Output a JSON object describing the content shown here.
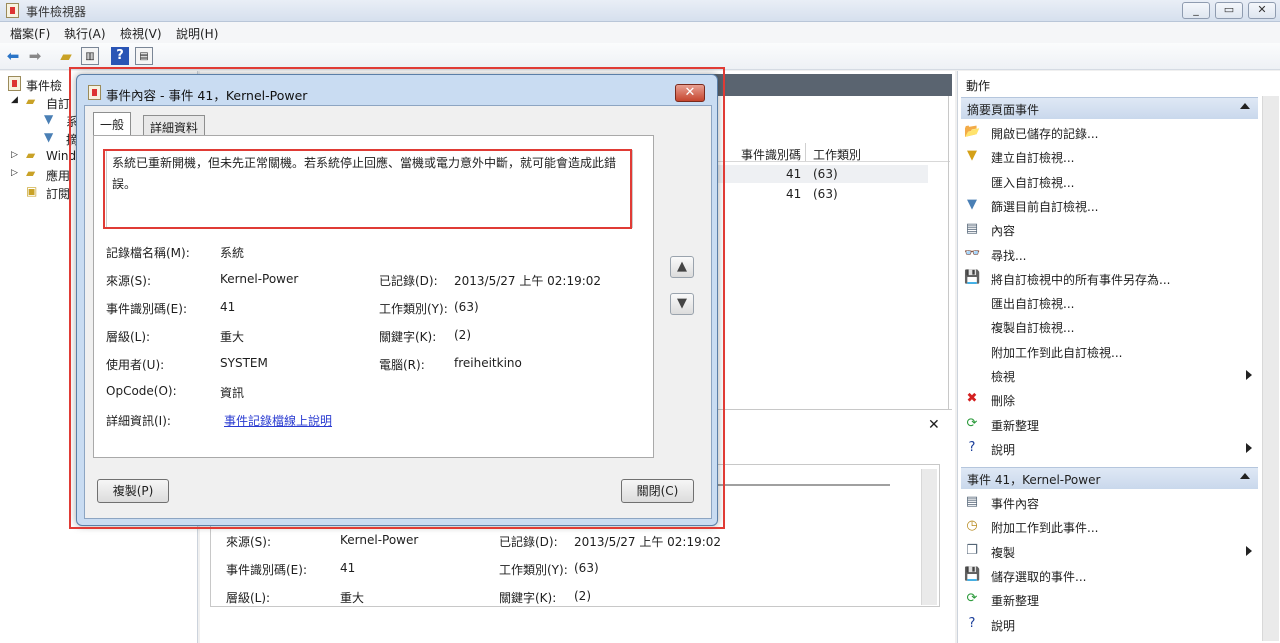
{
  "window": {
    "title": "事件檢視器",
    "controls": [
      "_",
      "▭",
      "✕"
    ]
  },
  "menu": [
    "檔案(F)",
    "執行(A)",
    "檢視(V)",
    "說明(H)"
  ],
  "tree": {
    "items": [
      "事件檢",
      "自訂",
      "系",
      "摘",
      "Wind",
      "應用",
      "訂閱"
    ]
  },
  "center": {
    "columns": [
      "事件識別碼",
      "工作類別"
    ],
    "rows": [
      {
        "id": "41",
        "category": "(63)"
      },
      {
        "id": "41",
        "category": "(63)"
      }
    ],
    "preview_close": "✕",
    "preview": {
      "source_label": "來源(S):",
      "source_value": "Kernel-Power",
      "logged_label": "已記錄(D):",
      "logged_value": "2013/5/27 上午 02:19:02",
      "eventid_label": "事件識別碼(E):",
      "eventid_value": "41",
      "task_label": "工作類別(Y):",
      "task_value": "(63)",
      "level_label": "層級(L):",
      "level_value": "重大",
      "keywords_label": "關鍵字(K):",
      "keywords_value": "(2)"
    }
  },
  "actions": {
    "header": "動作",
    "section1": "摘要頁面事件",
    "items1": [
      {
        "label": "開啟已儲存的記錄...",
        "icon": "open-folder-icon",
        "glyph": "📂",
        "color": "#c9a227"
      },
      {
        "label": "建立自訂檢視...",
        "icon": "filter-icon",
        "glyph": "▼",
        "color": "#d4a017"
      },
      {
        "label": "匯入自訂檢視...",
        "icon": "",
        "glyph": "",
        "color": "#000"
      },
      {
        "label": "篩選目前自訂檢視...",
        "icon": "filter-icon",
        "glyph": "▼",
        "color": "#4a7fb5"
      },
      {
        "label": "內容",
        "icon": "properties-icon",
        "glyph": "▤",
        "color": "#567"
      },
      {
        "label": "尋找...",
        "icon": "binoculars-icon",
        "glyph": "👓",
        "color": "#335"
      },
      {
        "label": "將自訂檢視中的所有事件另存為...",
        "icon": "save-icon",
        "glyph": "💾",
        "color": "#335"
      },
      {
        "label": "匯出自訂檢視...",
        "icon": "",
        "glyph": "",
        "color": "#000"
      },
      {
        "label": "複製自訂檢視...",
        "icon": "",
        "glyph": "",
        "color": "#000"
      },
      {
        "label": "附加工作到此自訂檢視...",
        "icon": "",
        "glyph": "",
        "color": "#000"
      },
      {
        "label": "檢視",
        "icon": "",
        "glyph": "",
        "color": "#000",
        "submenu": true
      },
      {
        "label": "刪除",
        "icon": "delete-icon",
        "glyph": "✖",
        "color": "#d42020"
      },
      {
        "label": "重新整理",
        "icon": "refresh-icon",
        "glyph": "⟳",
        "color": "#2a9a3a"
      },
      {
        "label": "說明",
        "icon": "help-icon",
        "glyph": "?",
        "color": "#1c3f9a",
        "submenu": true
      }
    ],
    "section2": "事件 41，Kernel-Power",
    "items2": [
      {
        "label": "事件內容",
        "icon": "event-properties-icon",
        "glyph": "▤",
        "color": "#567"
      },
      {
        "label": "附加工作到此事件...",
        "icon": "task-icon",
        "glyph": "◷",
        "color": "#b78a1f"
      },
      {
        "label": "複製",
        "icon": "copy-icon",
        "glyph": "❐",
        "color": "#567",
        "submenu": true
      },
      {
        "label": "儲存選取的事件...",
        "icon": "save-icon",
        "glyph": "💾",
        "color": "#335"
      },
      {
        "label": "重新整理",
        "icon": "refresh-icon",
        "glyph": "⟳",
        "color": "#2a9a3a"
      },
      {
        "label": "說明",
        "icon": "help-icon",
        "glyph": "?",
        "color": "#1c3f9a"
      }
    ]
  },
  "dialog": {
    "title": "事件內容 - 事件 41，Kernel-Power",
    "tabs": [
      "一般",
      "詳細資料"
    ],
    "description": "系統已重新開機，但未先正常關機。若系統停止回應、當機或電力意外中斷，就可能會造成此錯誤。",
    "log_name_label": "記錄檔名稱(M):",
    "log_name_value": "系統",
    "source_label": "來源(S):",
    "source_value": "Kernel-Power",
    "logged_label": "已記錄(D):",
    "logged_value": "2013/5/27 上午 02:19:02",
    "eventid_label": "事件識別碼(E):",
    "eventid_value": "41",
    "task_label": "工作類別(Y):",
    "task_value": "(63)",
    "level_label": "層級(L):",
    "level_value": "重大",
    "keywords_label": "關鍵字(K):",
    "keywords_value": "(2)",
    "user_label": "使用者(U):",
    "user_value": "SYSTEM",
    "computer_label": "電腦(R):",
    "computer_value": "freiheitkino",
    "opcode_label": "OpCode(O):",
    "opcode_value": "資訊",
    "more_info_label": "詳細資訊(I):",
    "more_info_link": "事件記錄檔線上說明",
    "copy_button": "複製(P)",
    "close_button": "關閉(C)",
    "close_x": "✕",
    "up_arrow": "▲",
    "down_arrow": "▼"
  },
  "colors": {
    "highlight": "#e03b35",
    "link": "#2a3bd1"
  }
}
